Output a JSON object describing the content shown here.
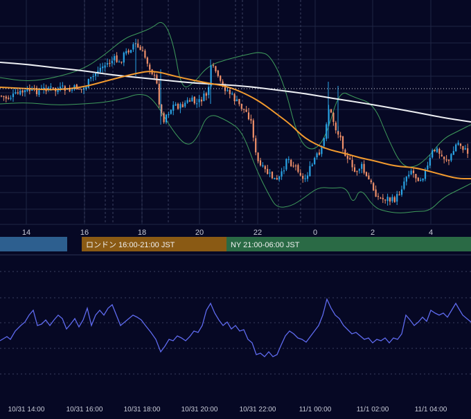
{
  "colors": {
    "background": "#060824",
    "grid_solid": "#1f2645",
    "grid_dashed": "#3a4160",
    "candle_up": "#2aa5e6",
    "candle_down": "#f0906a",
    "ma_fast": "#f29a2e",
    "ma_slow": "#eef0f4",
    "bollinger": "#3f9c5c",
    "oscillator": "#5f6bf0",
    "session_tokyo": "#2d5f8f",
    "session_london": "#8a5a14",
    "session_ny": "#2a6a45",
    "axis_text": "#c9ccd8"
  },
  "chart_data": [
    {
      "type": "candlestick",
      "panel": "price",
      "x_axis_hour_labels": [
        "14",
        "16",
        "18",
        "20",
        "22",
        "0",
        "2",
        "4"
      ],
      "series": [
        {
          "name": "candles"
        },
        {
          "name": "ma_fast"
        },
        {
          "name": "ma_slow"
        },
        {
          "name": "bollinger_upper"
        },
        {
          "name": "bollinger_lower"
        }
      ],
      "close_profile": [
        [
          0,
          138
        ],
        [
          10,
          142
        ],
        [
          20,
          138
        ],
        [
          30,
          134
        ],
        [
          40,
          130
        ],
        [
          50,
          132
        ],
        [
          60,
          130
        ],
        [
          70,
          126
        ],
        [
          80,
          131
        ],
        [
          90,
          128
        ],
        [
          100,
          132
        ],
        [
          110,
          126
        ],
        [
          120,
          130
        ],
        [
          128,
          118
        ],
        [
          135,
          110
        ],
        [
          142,
          100
        ],
        [
          150,
          95
        ],
        [
          158,
          90
        ],
        [
          166,
          85
        ],
        [
          172,
          92
        ],
        [
          178,
          80
        ],
        [
          186,
          72
        ],
        [
          194,
          62
        ],
        [
          200,
          70
        ],
        [
          208,
          80
        ],
        [
          214,
          92
        ],
        [
          220,
          105
        ],
        [
          226,
          120
        ],
        [
          230,
          148
        ],
        [
          235,
          175
        ],
        [
          240,
          165
        ],
        [
          245,
          160
        ],
        [
          252,
          150
        ],
        [
          260,
          155
        ],
        [
          268,
          148
        ],
        [
          276,
          145
        ],
        [
          284,
          150
        ],
        [
          292,
          142
        ],
        [
          300,
          135
        ],
        [
          304,
          100
        ],
        [
          310,
          98
        ],
        [
          316,
          118
        ],
        [
          322,
          125
        ],
        [
          328,
          130
        ],
        [
          336,
          140
        ],
        [
          344,
          150
        ],
        [
          352,
          158
        ],
        [
          358,
          165
        ],
        [
          364,
          180
        ],
        [
          370,
          230
        ],
        [
          376,
          240
        ],
        [
          384,
          248
        ],
        [
          392,
          255
        ],
        [
          400,
          262
        ],
        [
          408,
          250
        ],
        [
          414,
          225
        ],
        [
          420,
          235
        ],
        [
          426,
          240
        ],
        [
          432,
          245
        ],
        [
          438,
          262
        ],
        [
          444,
          250
        ],
        [
          450,
          240
        ],
        [
          456,
          225
        ],
        [
          462,
          225
        ],
        [
          468,
          200
        ],
        [
          474,
          155
        ],
        [
          480,
          170
        ],
        [
          486,
          190
        ],
        [
          492,
          200
        ],
        [
          498,
          220
        ],
        [
          504,
          230
        ],
        [
          510,
          250
        ],
        [
          516,
          245
        ],
        [
          522,
          240
        ],
        [
          528,
          255
        ],
        [
          534,
          262
        ],
        [
          540,
          275
        ],
        [
          546,
          285
        ],
        [
          552,
          288
        ],
        [
          558,
          285
        ],
        [
          564,
          290
        ],
        [
          570,
          288
        ],
        [
          576,
          280
        ],
        [
          582,
          265
        ],
        [
          588,
          250
        ],
        [
          594,
          245
        ],
        [
          600,
          255
        ],
        [
          606,
          258
        ],
        [
          612,
          252
        ],
        [
          618,
          240
        ],
        [
          624,
          220
        ],
        [
          630,
          215
        ],
        [
          636,
          225
        ],
        [
          642,
          228
        ],
        [
          648,
          232
        ],
        [
          654,
          220
        ],
        [
          660,
          205
        ],
        [
          666,
          210
        ],
        [
          672,
          218
        ],
        [
          680,
          222
        ]
      ],
      "ma_fast": [
        [
          0,
          126
        ],
        [
          40,
          128
        ],
        [
          80,
          130
        ],
        [
          120,
          126
        ],
        [
          160,
          115
        ],
        [
          200,
          105
        ],
        [
          222,
          102
        ],
        [
          260,
          112
        ],
        [
          300,
          120
        ],
        [
          330,
          125
        ],
        [
          360,
          138
        ],
        [
          380,
          150
        ],
        [
          400,
          165
        ],
        [
          420,
          180
        ],
        [
          440,
          200
        ],
        [
          470,
          215
        ],
        [
          500,
          222
        ],
        [
          520,
          228
        ],
        [
          540,
          232
        ],
        [
          570,
          240
        ],
        [
          600,
          242
        ],
        [
          630,
          250
        ],
        [
          660,
          258
        ],
        [
          680,
          258
        ]
      ],
      "ma_slow": [
        [
          0,
          90
        ],
        [
          40,
          93
        ],
        [
          80,
          98
        ],
        [
          120,
          102
        ],
        [
          160,
          108
        ],
        [
          200,
          112
        ],
        [
          240,
          116
        ],
        [
          280,
          120
        ],
        [
          320,
          122
        ],
        [
          360,
          125
        ],
        [
          400,
          130
        ],
        [
          440,
          135
        ],
        [
          480,
          142
        ],
        [
          520,
          148
        ],
        [
          560,
          155
        ],
        [
          600,
          162
        ],
        [
          640,
          170
        ],
        [
          680,
          176
        ]
      ],
      "bollinger_upper": [
        [
          0,
          112
        ],
        [
          40,
          118
        ],
        [
          80,
          112
        ],
        [
          120,
          100
        ],
        [
          150,
          80
        ],
        [
          180,
          55
        ],
        [
          200,
          48
        ],
        [
          220,
          40
        ],
        [
          235,
          28
        ],
        [
          250,
          60
        ],
        [
          262,
          130
        ],
        [
          280,
          120
        ],
        [
          300,
          95
        ],
        [
          330,
          85
        ],
        [
          360,
          78
        ],
        [
          375,
          75
        ],
        [
          390,
          80
        ],
        [
          410,
          120
        ],
        [
          430,
          200
        ],
        [
          450,
          220
        ],
        [
          470,
          200
        ],
        [
          490,
          130
        ],
        [
          510,
          140
        ],
        [
          540,
          150
        ],
        [
          560,
          200
        ],
        [
          580,
          240
        ],
        [
          600,
          242
        ],
        [
          620,
          225
        ],
        [
          640,
          200
        ],
        [
          660,
          190
        ],
        [
          680,
          180
        ]
      ],
      "bollinger_lower": [
        [
          0,
          150
        ],
        [
          40,
          148
        ],
        [
          80,
          152
        ],
        [
          120,
          150
        ],
        [
          150,
          148
        ],
        [
          180,
          142
        ],
        [
          200,
          135
        ],
        [
          220,
          140
        ],
        [
          250,
          190
        ],
        [
          270,
          212
        ],
        [
          285,
          200
        ],
        [
          300,
          162
        ],
        [
          330,
          175
        ],
        [
          350,
          190
        ],
        [
          370,
          245
        ],
        [
          390,
          285
        ],
        [
          400,
          300
        ],
        [
          420,
          298
        ],
        [
          440,
          285
        ],
        [
          460,
          270
        ],
        [
          480,
          272
        ],
        [
          500,
          270
        ],
        [
          510,
          296
        ],
        [
          520,
          270
        ],
        [
          540,
          300
        ],
        [
          560,
          306
        ],
        [
          580,
          308
        ],
        [
          600,
          305
        ],
        [
          620,
          305
        ],
        [
          640,
          285
        ],
        [
          660,
          275
        ],
        [
          680,
          265
        ]
      ]
    },
    {
      "type": "line",
      "panel": "oscillator",
      "x_axis_date_labels": [
        "10/31 14:00",
        "10/31 16:00",
        "10/31 18:00",
        "10/31 20:00",
        "10/31 22:00",
        "11/1 00:00",
        "11/1 02:00",
        "11/1 04:00"
      ],
      "series": [
        {
          "name": "oscillator",
          "profile": [
            [
              0,
              492
            ],
            [
              10,
              486
            ],
            [
              15,
              490
            ],
            [
              22,
              478
            ],
            [
              30,
              470
            ],
            [
              36,
              465
            ],
            [
              42,
              455
            ],
            [
              48,
              448
            ],
            [
              54,
              470
            ],
            [
              60,
              468
            ],
            [
              66,
              462
            ],
            [
              72,
              470
            ],
            [
              78,
              462
            ],
            [
              84,
              455
            ],
            [
              90,
              460
            ],
            [
              96,
              475
            ],
            [
              102,
              468
            ],
            [
              108,
              460
            ],
            [
              114,
              472
            ],
            [
              120,
              462
            ],
            [
              126,
              445
            ],
            [
              132,
              470
            ],
            [
              138,
              455
            ],
            [
              144,
              448
            ],
            [
              150,
              455
            ],
            [
              156,
              445
            ],
            [
              162,
              440
            ],
            [
              168,
              455
            ],
            [
              174,
              470
            ],
            [
              180,
              465
            ],
            [
              186,
              460
            ],
            [
              192,
              455
            ],
            [
              198,
              458
            ],
            [
              204,
              462
            ],
            [
              210,
              470
            ],
            [
              218,
              480
            ],
            [
              225,
              490
            ],
            [
              232,
              508
            ],
            [
              238,
              500
            ],
            [
              244,
              490
            ],
            [
              250,
              492
            ],
            [
              256,
              485
            ],
            [
              262,
              488
            ],
            [
              268,
              492
            ],
            [
              274,
              486
            ],
            [
              280,
              478
            ],
            [
              286,
              480
            ],
            [
              292,
              470
            ],
            [
              298,
              448
            ],
            [
              304,
              438
            ],
            [
              310,
              452
            ],
            [
              316,
              462
            ],
            [
              322,
              470
            ],
            [
              328,
              465
            ],
            [
              334,
              475
            ],
            [
              340,
              470
            ],
            [
              346,
              478
            ],
            [
              352,
              476
            ],
            [
              358,
              490
            ],
            [
              364,
              495
            ],
            [
              370,
              512
            ],
            [
              376,
              510
            ],
            [
              382,
              515
            ],
            [
              388,
              508
            ],
            [
              394,
              515
            ],
            [
              400,
              512
            ],
            [
              406,
              498
            ],
            [
              412,
              485
            ],
            [
              418,
              478
            ],
            [
              424,
              482
            ],
            [
              430,
              488
            ],
            [
              436,
              490
            ],
            [
              442,
              494
            ],
            [
              448,
              486
            ],
            [
              454,
              478
            ],
            [
              460,
              470
            ],
            [
              466,
              455
            ],
            [
              472,
              432
            ],
            [
              478,
              445
            ],
            [
              484,
              455
            ],
            [
              490,
              460
            ],
            [
              496,
              470
            ],
            [
              502,
              476
            ],
            [
              508,
              482
            ],
            [
              514,
              480
            ],
            [
              520,
              485
            ],
            [
              526,
              490
            ],
            [
              532,
              488
            ],
            [
              538,
              495
            ],
            [
              544,
              490
            ],
            [
              550,
              492
            ],
            [
              556,
              488
            ],
            [
              562,
              495
            ],
            [
              568,
              488
            ],
            [
              574,
              490
            ],
            [
              580,
              482
            ],
            [
              586,
              455
            ],
            [
              592,
              462
            ],
            [
              598,
              470
            ],
            [
              604,
              465
            ],
            [
              610,
              458
            ],
            [
              616,
              464
            ],
            [
              622,
              448
            ],
            [
              628,
              452
            ],
            [
              634,
              455
            ],
            [
              640,
              452
            ],
            [
              646,
              458
            ],
            [
              652,
              448
            ],
            [
              658,
              438
            ],
            [
              662,
              445
            ],
            [
              668,
              455
            ],
            [
              674,
              460
            ],
            [
              680,
              465
            ]
          ]
        }
      ]
    }
  ],
  "sessions": [
    {
      "name": "tokyo",
      "label": ""
    },
    {
      "name": "london",
      "label": "ロンドン 16:00-21:00 JST"
    },
    {
      "name": "ny",
      "label": "NY 21:00-06:00 JST"
    }
  ]
}
